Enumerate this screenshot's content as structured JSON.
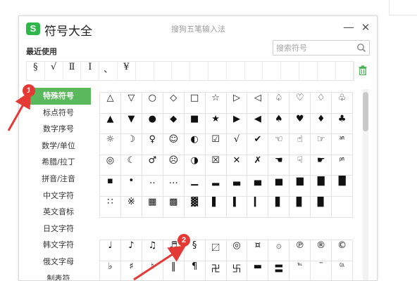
{
  "window": {
    "title": "符号大全",
    "subtitle": "搜狗五笔输入法",
    "logo_letter": "S",
    "min_glyph": "—",
    "close_glyph": "✕",
    "accent_color": "#5cb85c"
  },
  "recent": {
    "label": "最近使用",
    "symbols": [
      "§",
      "√",
      "Ⅱ",
      "Ⅰ",
      "、",
      "¥",
      "",
      "",
      "",
      "",
      "",
      "",
      "",
      "",
      "",
      "",
      "",
      ""
    ]
  },
  "search": {
    "placeholder": "搜索符号"
  },
  "sidebar": {
    "items": [
      {
        "label": "特殊符号",
        "active": true
      },
      {
        "label": "标点符号",
        "active": false
      },
      {
        "label": "数字序号",
        "active": false
      },
      {
        "label": "数学/单位",
        "active": false
      },
      {
        "label": "希腊/拉丁",
        "active": false
      },
      {
        "label": "拼音/注音",
        "active": false
      },
      {
        "label": "中文字符",
        "active": false
      },
      {
        "label": "英文音标",
        "active": false
      },
      {
        "label": "日文字符",
        "active": false
      },
      {
        "label": "韩文字符",
        "active": false
      },
      {
        "label": "俄文字母",
        "active": false
      },
      {
        "label": "制表符",
        "active": false
      }
    ]
  },
  "symbol_block_1": [
    [
      "△",
      "▽",
      "○",
      "◇",
      "□",
      "☆",
      "▷",
      "◁",
      "♤",
      "♡",
      "♢",
      "♧"
    ],
    [
      "▲",
      "▼",
      "●",
      "◆",
      "■",
      "★",
      "▶",
      "◀",
      "♠",
      "♥",
      "♦",
      "♣"
    ],
    [
      "☼",
      "☽",
      "♀",
      "☺",
      "◐",
      "☑",
      "√",
      "✔",
      "☜",
      "☝",
      "☞",
      "㏂"
    ],
    [
      "◎",
      "☾",
      "♂",
      "☹",
      "◑",
      "☒",
      "✕",
      "✗",
      "☚",
      "☟",
      "☛",
      "㏘"
    ],
    [
      "▪",
      "•",
      "‥",
      "…",
      "▁",
      "▂",
      "▃",
      "▄",
      "▅",
      "▆",
      "▇",
      "█"
    ],
    [
      "∷",
      "※",
      "▦",
      "▩",
      "▓",
      "▌",
      "▍",
      "▎",
      "▋",
      "▊",
      "▉",
      ""
    ]
  ],
  "symbol_block_2": [
    [
      "♩",
      "♪",
      "♫",
      "♬",
      "§",
      "〼",
      "◎",
      "¤",
      "۞",
      "℗",
      "®",
      "©"
    ],
    [
      "♭",
      "♯",
      "♮",
      "‖",
      "¶",
      "卍",
      "卐",
      "▬",
      "〓",
      "℡",
      "™",
      "㏇"
    ]
  ],
  "annotations": [
    "1",
    "2"
  ],
  "annotation_color": "#e53935"
}
